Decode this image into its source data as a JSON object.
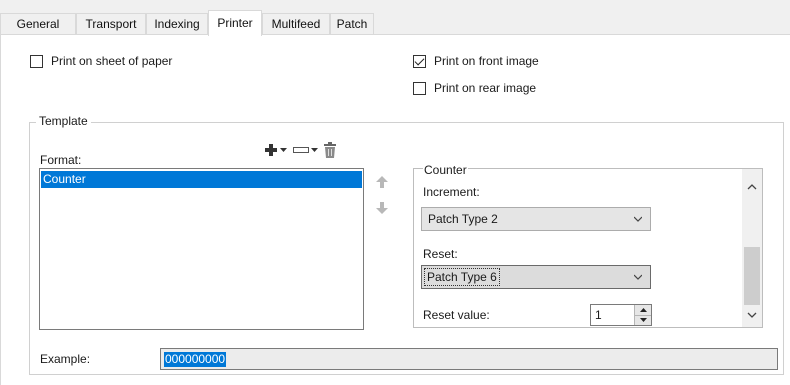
{
  "tabs": [
    {
      "label": "General",
      "active": false
    },
    {
      "label": "Transport",
      "active": false
    },
    {
      "label": "Indexing",
      "active": false
    },
    {
      "label": "Printer",
      "active": true
    },
    {
      "label": "Multifeed",
      "active": false
    },
    {
      "label": "Patch",
      "active": false
    }
  ],
  "options": {
    "print_on_sheet": {
      "label": "Print on sheet of paper",
      "checked": false
    },
    "print_front": {
      "label": "Print on front image",
      "checked": true
    },
    "print_rear": {
      "label": "Print on rear image",
      "checked": false
    }
  },
  "template": {
    "title": "Template",
    "format_label": "Format:",
    "format_items": [
      "Counter"
    ],
    "selected_item": "Counter",
    "toolbar": {
      "add_icon": "plus-icon",
      "field_icon": "field-icon",
      "delete_icon": "trash-icon"
    },
    "move_up_icon": "arrow-up-icon",
    "move_down_icon": "arrow-down-icon"
  },
  "counter": {
    "title": "Counter",
    "increment_label": "Increment:",
    "increment_value": "Patch Type 2",
    "reset_label": "Reset:",
    "reset_value": "Patch Type 6",
    "reset_value_label": "Reset value:",
    "reset_value_number": "1"
  },
  "example": {
    "label": "Example:",
    "value": "000000000"
  },
  "colors": {
    "selection": "#0078d7",
    "tab_background": "#f0f0f0",
    "border": "#d9d9d9"
  }
}
